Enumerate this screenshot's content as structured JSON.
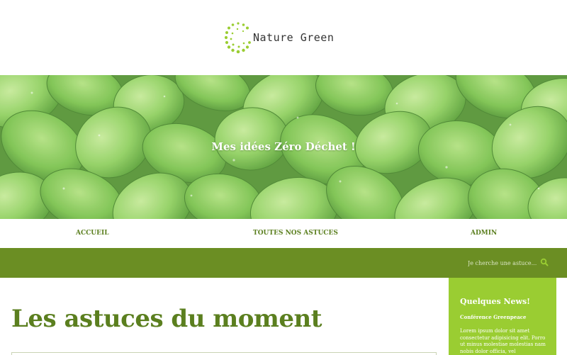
{
  "brand": {
    "name": "Nature Green",
    "accent": "#9acd32",
    "dark_green": "#6b8e23",
    "text_green": "#5b7f1f",
    "logo_icon": "dotted-circle-logo-icon"
  },
  "hero": {
    "title": "Mes idées Zéro Déchet !"
  },
  "nav": {
    "items": [
      "ACCUEIL",
      "TOUTES NOS ASTUCES",
      "ADMIN"
    ]
  },
  "search": {
    "placeholder": "Je cherche une astuce...",
    "icon": "search-icon"
  },
  "main": {
    "title": "Les astuces du moment"
  },
  "sidebar": {
    "title": "Quelques News!",
    "news": [
      {
        "title": "Conférence Greenpeace",
        "body": "Lorem ipsum dolor sit amet consectetur adipisicing elit. Porro ut minus molestiae molestias nam nobis dolor officia, vel consequuntur"
      }
    ]
  }
}
